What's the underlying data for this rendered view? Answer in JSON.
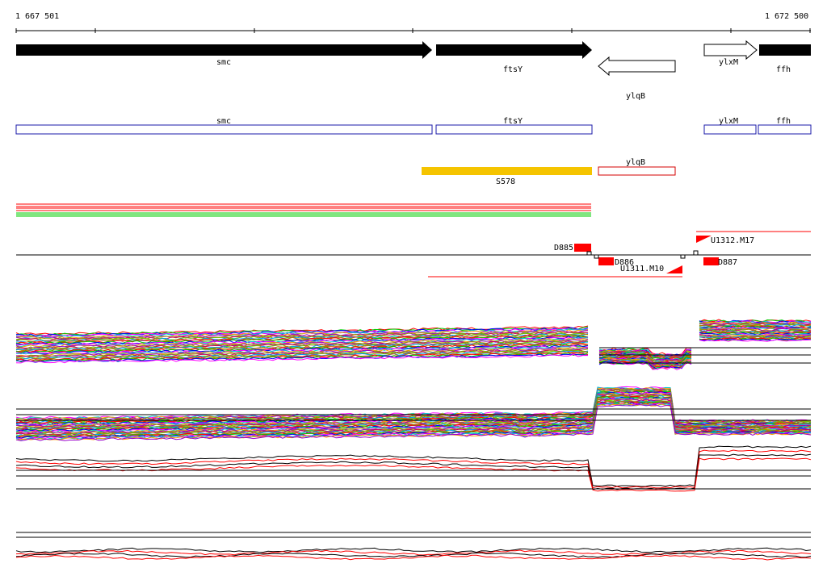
{
  "ruler": {
    "start": "1 667 501",
    "end": "1 672 500"
  },
  "colors": {
    "gene_solid": "#000000",
    "gene_hollow_stroke": "#000000",
    "annotation_box": "#1a1aa8",
    "annotation_red": "#d40000",
    "s578": "#f5c400",
    "promoter": "#ff0000",
    "guide": "#000000"
  },
  "genes": [
    {
      "label": "smc",
      "strand": "+",
      "style": "solid"
    },
    {
      "label": "ftsY",
      "strand": "+",
      "style": "solid"
    },
    {
      "label": "ylqB",
      "strand": "-",
      "style": "hollow"
    },
    {
      "label": "ylxM",
      "strand": "+",
      "style": "hollow"
    },
    {
      "label": "ffh",
      "strand": "+",
      "style": "solid"
    }
  ],
  "annotations": [
    {
      "label": "smc",
      "color": "annotation_box"
    },
    {
      "label": "ftsY",
      "color": "annotation_box"
    },
    {
      "label": "ylqB",
      "color": "annotation_red"
    },
    {
      "label": "ylxM",
      "color": "annotation_box"
    },
    {
      "label": "ffh",
      "color": "annotation_box"
    }
  ],
  "segment": {
    "label": "S578"
  },
  "features": [
    {
      "label": "D885",
      "type": "terminator"
    },
    {
      "label": "D886",
      "type": "terminator"
    },
    {
      "label": "U1311.M10",
      "type": "promoter"
    },
    {
      "label": "U1312.M17",
      "type": "promoter"
    },
    {
      "label": "D887",
      "type": "terminator"
    }
  ],
  "tracks": {
    "profile_colors": [
      "#ff0000",
      "#00cc00",
      "#0000ff",
      "#ff00ff",
      "#00cccc",
      "#ff9900",
      "#9900cc",
      "#999900",
      "#cc0066",
      "#66cc00",
      "#0099ff",
      "#cc6600"
    ],
    "summary_colors": [
      "#000000",
      "#ff0000"
    ]
  }
}
